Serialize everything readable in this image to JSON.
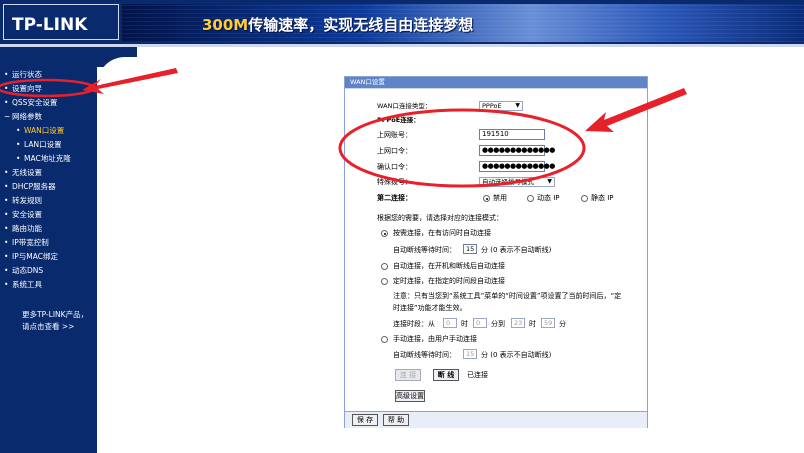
{
  "header": {
    "logo": "TP-LINK",
    "slogan_speed": "300M",
    "slogan_rest": "传输速率，实现无线自由连接梦想"
  },
  "sidebar": {
    "items": [
      {
        "label": "运行状态",
        "level": 0
      },
      {
        "label": "设置向导",
        "level": 0
      },
      {
        "label": "QSS安全设置",
        "level": 0
      },
      {
        "label": "网络参数",
        "level": 0,
        "expanded": true
      },
      {
        "label": "WAN口设置",
        "level": 1,
        "active": true
      },
      {
        "label": "LAN口设置",
        "level": 1
      },
      {
        "label": "MAC地址克隆",
        "level": 1
      },
      {
        "label": "无线设置",
        "level": 0
      },
      {
        "label": "DHCP服务器",
        "level": 0
      },
      {
        "label": "转发规则",
        "level": 0
      },
      {
        "label": "安全设置",
        "level": 0
      },
      {
        "label": "路由功能",
        "level": 0
      },
      {
        "label": "IP带宽控制",
        "level": 0
      },
      {
        "label": "IP与MAC绑定",
        "level": 0
      },
      {
        "label": "动态DNS",
        "level": 0
      },
      {
        "label": "系统工具",
        "level": 0
      }
    ],
    "more_line1": "更多TP-LINK产品，",
    "more_line2": "请点击查看 >>"
  },
  "panel": {
    "title": "WAN口设置",
    "wan_type_label": "WAN口连接类型：",
    "wan_type_value": "PPPoE",
    "pppoe_header": "PPPoE连接：",
    "account_label": "上网账号：",
    "account_value": "191510",
    "password_label": "上网口令：",
    "password_value": "●●●●●●●●●●●●●",
    "confirm_label": "确认口令：",
    "confirm_value": "●●●●●●●●●●●●●",
    "special_dial_label": "特殊拨号：",
    "special_dial_value": "自动选择拨号模式",
    "second_conn_label": "第二连接：",
    "second_opts": [
      "禁用",
      "动态 IP",
      "静态 IP"
    ],
    "mode_intro": "根据您的需要，请选择对应的连接模式：",
    "mode_on_demand": "按需连接，在有访问时自动连接",
    "idle_wait_label": "自动断线等待时间：",
    "idle_wait_value": "15",
    "idle_wait_unit": "分 (0 表示不自动断线)",
    "mode_auto": "自动连接，在开机和断线后自动连接",
    "mode_timed": "定时连接，在指定的时间段自动连接",
    "timed_note1": "注意：只有当您到“系统工具”菜单的“时间设置”项设置了当前时间后，“定",
    "timed_note2": "时连接”功能才能生效。",
    "period_label": "连接时段：从",
    "period_from_h": "0",
    "period_from_h_unit": "时",
    "period_from_m": "0",
    "period_from_m_unit": "分到",
    "period_to_h": "23",
    "period_to_h_unit": "时",
    "period_to_m": "59",
    "period_to_m_unit": "分",
    "mode_manual": "手动连接，由用户手动连接",
    "idle_wait2_label": "自动断线等待时间：",
    "idle_wait2_value": "15",
    "idle_wait2_unit": "分 (0 表示不自动断线)",
    "connect_btn": "连 接",
    "disconnect_btn": "断 线",
    "status_text": "已连接",
    "advanced_btn": "高级设置",
    "save_btn": "保 存",
    "help_btn": "帮 助"
  },
  "colors": {
    "navy": "#0a2a6e",
    "panel_title": "#5f84c8",
    "annotation_red": "#e8202a"
  }
}
